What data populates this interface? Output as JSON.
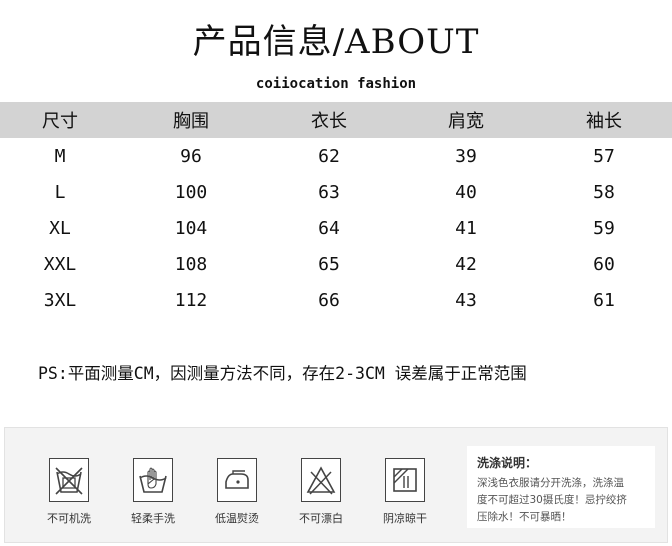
{
  "title": "产品信息/ABOUT",
  "brand": "coiiocation fashion",
  "table": {
    "headers": [
      "尺寸",
      "胸围",
      "衣长",
      "肩宽",
      "袖长"
    ],
    "rows": [
      [
        "M",
        "96",
        "62",
        "39",
        "57"
      ],
      [
        "L",
        "100",
        "63",
        "40",
        "58"
      ],
      [
        "XL",
        "104",
        "64",
        "41",
        "59"
      ],
      [
        "XXL",
        "108",
        "65",
        "42",
        "60"
      ],
      [
        "3XL",
        "112",
        "66",
        "43",
        "61"
      ]
    ]
  },
  "note": "PS:平面测量CM，因测量方法不同，存在2-3CM 误差属于正常范围",
  "care": {
    "items": [
      {
        "icon": "no-machine-wash-icon",
        "label": "不可机洗"
      },
      {
        "icon": "hand-wash-icon",
        "label": "轻柔手洗"
      },
      {
        "icon": "low-temp-iron-icon",
        "label": "低温熨烫"
      },
      {
        "icon": "no-bleach-icon",
        "label": "不可漂白"
      },
      {
        "icon": "shade-dry-icon",
        "label": "阴凉晾干"
      }
    ],
    "note_title": "洗涤说明：",
    "note_lines": [
      "深浅色衣服请分开洗涤，洗涤温",
      "度不可超过30摄氏度！忌拧绞挤",
      "压除水！不可暴晒！"
    ]
  },
  "colors": {
    "header_bg": "#d3d3d3",
    "care_bg": "#f3f3f3"
  }
}
